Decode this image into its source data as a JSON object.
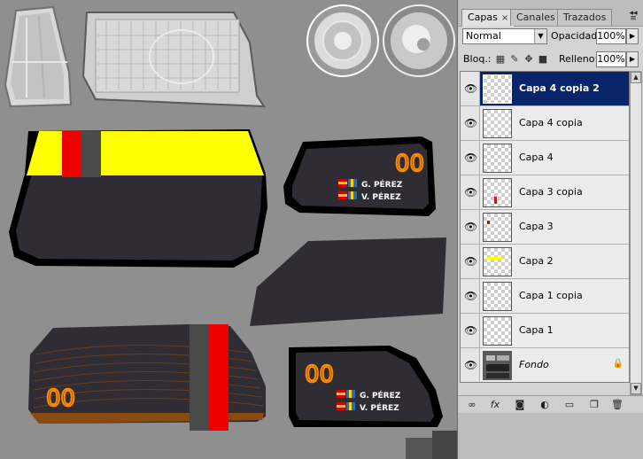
{
  "canvas": {
    "background": "#8f8f8f",
    "stickers": {
      "top_number": "00",
      "bottom_number": "00",
      "left_number": "00",
      "driver": "G. PÉREZ",
      "codriver": "V. PÉREZ"
    },
    "colors": {
      "glass": "#2f2d33",
      "outline": "#000000",
      "yellow": "#ffff00",
      "red": "#ee0000",
      "grey_stripe": "#4a4a4a",
      "orange": "#ff8a00"
    }
  },
  "panel": {
    "tabs": [
      {
        "label": "Capas",
        "active": true,
        "close": "×"
      },
      {
        "label": "Canales",
        "active": false
      },
      {
        "label": "Trazados",
        "active": false
      }
    ],
    "blend_mode": "Normal",
    "opacity_label": "Opacidad:",
    "opacity_value": "100%",
    "lock_label": "Bloq.:",
    "fill_label": "Relleno:",
    "fill_value": "100%",
    "layers": [
      {
        "name": "Capa 4 copia 2",
        "selected": true
      },
      {
        "name": "Capa 4 copia",
        "selected": false
      },
      {
        "name": "Capa 4",
        "selected": false
      },
      {
        "name": "Capa 3 copia",
        "selected": false
      },
      {
        "name": "Capa 3",
        "selected": false
      },
      {
        "name": "Capa 2",
        "selected": false
      },
      {
        "name": "Capa 1 copia",
        "selected": false
      },
      {
        "name": "Capa 1",
        "selected": false
      },
      {
        "name": "Fondo",
        "selected": false,
        "locked": true
      }
    ],
    "bottom_icons": [
      "link-icon",
      "fx-icon",
      "mask-icon",
      "adjustment-icon",
      "group-icon",
      "new-layer-icon",
      "trash-icon"
    ]
  }
}
